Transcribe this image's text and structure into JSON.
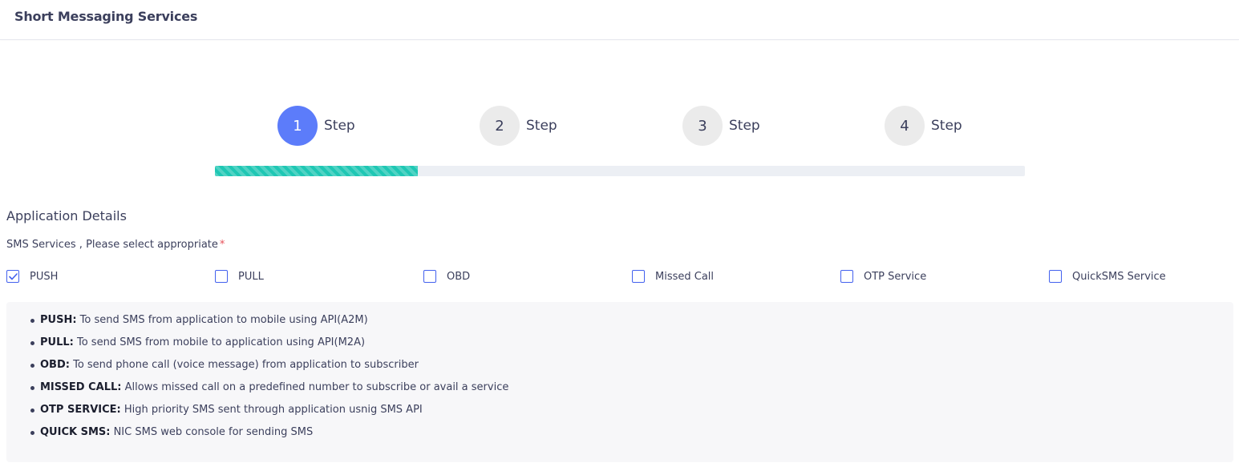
{
  "header": {
    "title": "Short Messaging Services"
  },
  "steps": [
    {
      "number": "1",
      "label": "Step",
      "active": true
    },
    {
      "number": "2",
      "label": "Step",
      "active": false
    },
    {
      "number": "3",
      "label": "Step",
      "active": false
    },
    {
      "number": "4",
      "label": "Step",
      "active": false
    }
  ],
  "progress": {
    "fraction": 0.25,
    "color": "#1fc7b4"
  },
  "form": {
    "section_title": "Application Details",
    "field_label": "SMS Services , Please select appropriate",
    "required_mark": "*",
    "options": [
      {
        "label": "PUSH",
        "checked": true
      },
      {
        "label": "PULL",
        "checked": false
      },
      {
        "label": "OBD",
        "checked": false
      },
      {
        "label": "Missed Call",
        "checked": false
      },
      {
        "label": "OTP Service",
        "checked": false
      },
      {
        "label": "QuickSMS Service",
        "checked": false
      }
    ]
  },
  "info": {
    "items": [
      {
        "key": "PUSH:",
        "text": " To send SMS from application to mobile using API(A2M)"
      },
      {
        "key": "PULL:",
        "text": " To send SMS from mobile to application using API(M2A)"
      },
      {
        "key": "OBD:",
        "text": " To send phone call (voice message) from application to subscriber"
      },
      {
        "key": "MISSED CALL:",
        "text": " Allows missed call on a predefined number to subscribe or avail a service"
      },
      {
        "key": "OTP SERVICE:",
        "text": " High priority SMS sent through application usnig SMS API"
      },
      {
        "key": "QUICK SMS:",
        "text": " NIC SMS web console for sending SMS"
      }
    ]
  },
  "colors": {
    "accent": "#5c7cfa",
    "checkbox_border": "#4361ee",
    "required": "#e7515a",
    "text": "#3b3f5c"
  },
  "icons": {
    "check": "checkmark-icon"
  }
}
